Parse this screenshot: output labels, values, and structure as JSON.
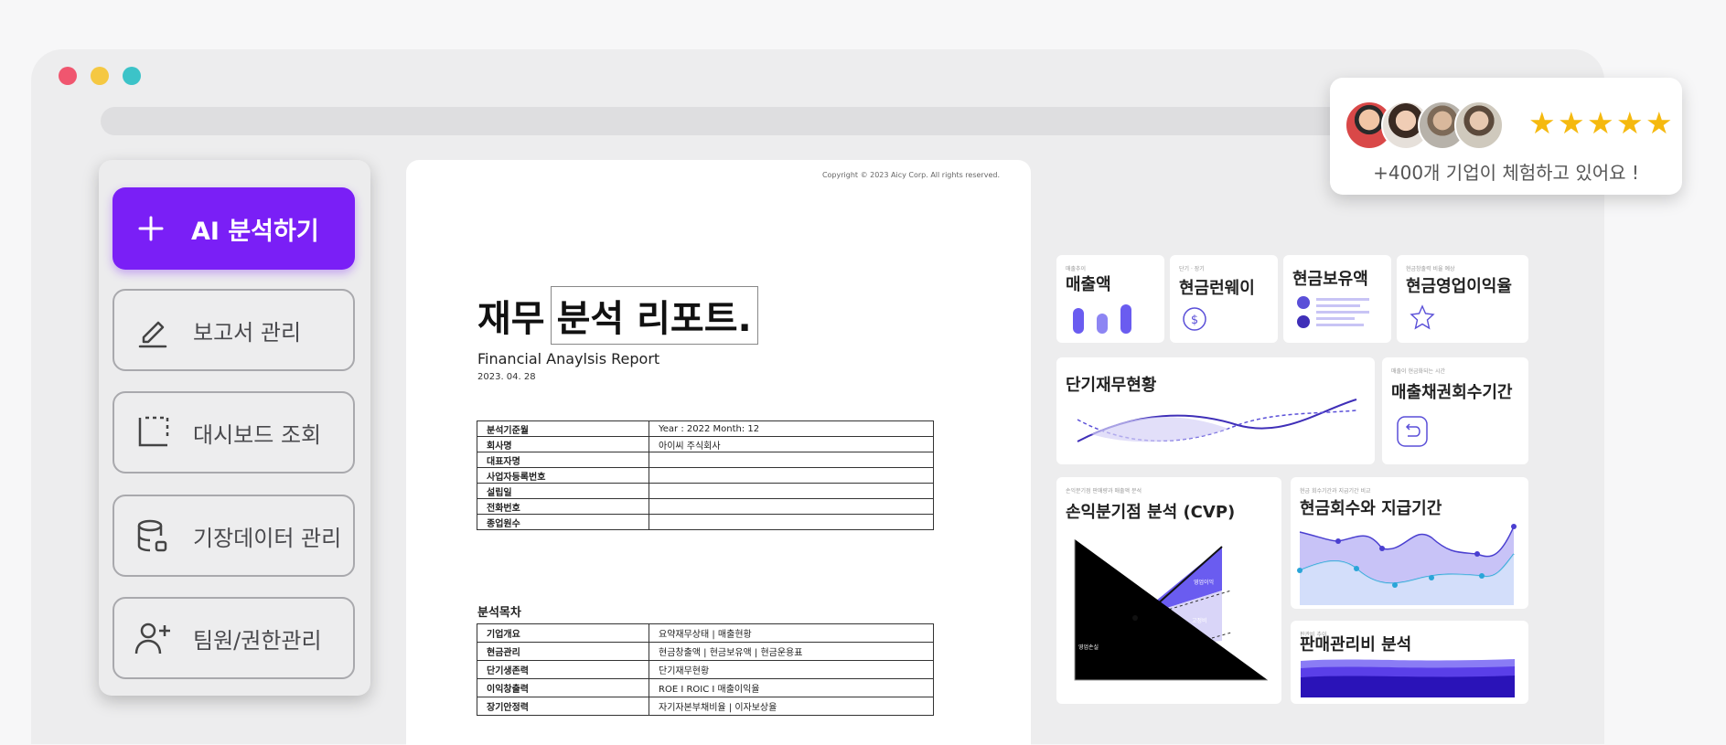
{
  "menu": {
    "items": [
      {
        "label": "AI 분석하기",
        "icon": "plus-icon"
      },
      {
        "label": "보고서 관리",
        "icon": "pencil-icon"
      },
      {
        "label": "대시보드 조회",
        "icon": "dashboard-icon"
      },
      {
        "label": "기장데이터 관리",
        "icon": "database-icon"
      },
      {
        "label": "팀원/권한관리",
        "icon": "add-user-icon"
      }
    ]
  },
  "report": {
    "copyright": "Copyright © 2023 Aicy Corp. All rights reserved.",
    "title_part1": "재무",
    "title_part2": "분석 리포트.",
    "subtitle": "Financial Anaylsis Report",
    "date": "2023. 04. 28",
    "info_rows": [
      {
        "key": "분석기준월",
        "value": "Year : 2022  Month: 12"
      },
      {
        "key": "회사명",
        "value": "아이씨 주식회사"
      },
      {
        "key": "대표자명",
        "value": ""
      },
      {
        "key": "사업자등록번호",
        "value": ""
      },
      {
        "key": "설립일",
        "value": ""
      },
      {
        "key": "전화번호",
        "value": ""
      },
      {
        "key": "종업원수",
        "value": ""
      }
    ],
    "toc_title": "분석목차",
    "toc_rows": [
      {
        "key": "기업개요",
        "value": "요약재무상태 | 매출현황"
      },
      {
        "key": "현금관리",
        "value": "현금창출액 | 현금보유액 | 현금운용표"
      },
      {
        "key": "단기생존력",
        "value": "단기재무현황"
      },
      {
        "key": "이익창출력",
        "value": "ROE I ROIC I 매출이익율"
      },
      {
        "key": "장기안정력",
        "value": "자기자본부채비율 | 이자보상율"
      }
    ]
  },
  "dashboard": {
    "sales": {
      "tiny": "매출추이",
      "title": "매출액"
    },
    "runway": {
      "tiny": "단기 · 장기",
      "title": "현금런웨이"
    },
    "cash": {
      "title": "현금보유액"
    },
    "op_margin": {
      "tiny": "현금창출력 비율 예상",
      "title": "현금영업이익율"
    },
    "short_term": {
      "title": "단기재무현황"
    },
    "receivables": {
      "tiny": "매출이 현금화되는 시간",
      "title": "매출채권회수기간"
    },
    "cvp": {
      "tiny": "손익분기점 판매량과 매출액 분석",
      "title": "손익분기점 분석 (CVP)",
      "label_loss": "영업손실",
      "label_profit": "영업이익",
      "label_fixed": "고정비"
    },
    "cash_cycle": {
      "tiny": "현금 회수기간과 지급기간 비교",
      "title": "현금회수와 지급기간"
    },
    "sga": {
      "tiny": "판관비 추이",
      "title": "판매관리비 분석"
    }
  },
  "rating": {
    "stars": 5,
    "text": "+400개 기업이 체험하고 있어요 !"
  },
  "colors": {
    "accent": "#7a1ff6",
    "star": "#f5b90f",
    "window_dot_red": "#f0566f",
    "window_dot_yellow": "#f5c842",
    "window_dot_teal": "#3cc3c8"
  }
}
